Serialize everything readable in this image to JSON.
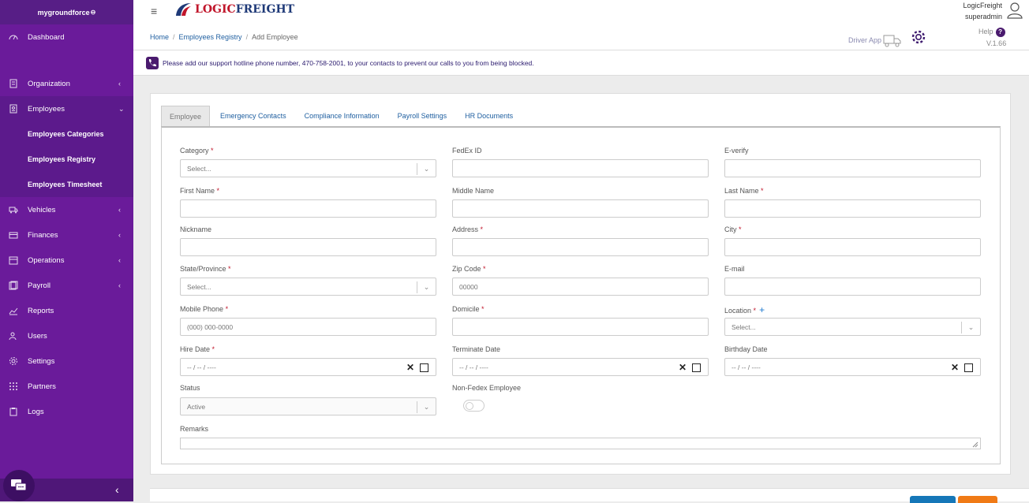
{
  "sidebar": {
    "brand": "mygroundforce",
    "items": [
      {
        "label": "Dashboard",
        "icon": "dashboard-icon"
      },
      {
        "label": "Organization",
        "icon": "building-icon"
      },
      {
        "label": "Employees",
        "icon": "id-badge-icon"
      },
      {
        "label": "Vehicles",
        "icon": "truck-icon"
      },
      {
        "label": "Finances",
        "icon": "wallet-icon"
      },
      {
        "label": "Operations",
        "icon": "calendar-icon"
      },
      {
        "label": "Payroll",
        "icon": "payroll-icon"
      },
      {
        "label": "Reports",
        "icon": "chart-icon"
      },
      {
        "label": "Users",
        "icon": "users-icon"
      },
      {
        "label": "Settings",
        "icon": "gear-icon"
      },
      {
        "label": "Partners",
        "icon": "grid-icon"
      },
      {
        "label": "Logs",
        "icon": "clipboard-icon"
      }
    ],
    "sub_items": [
      "Employees Categories",
      "Employees Registry",
      "Employees Timesheet"
    ]
  },
  "header": {
    "logo": {
      "part1": "LOGIC",
      "part2": "FREIGHT"
    },
    "user": {
      "name": "LogicFreight",
      "role": "superadmin"
    },
    "driver_app": "Driver App",
    "help": "Help",
    "help_icon": "?",
    "version": "V.1.66"
  },
  "breadcrumb": {
    "home": "Home",
    "registry": "Employees Registry",
    "current": "Add Employee"
  },
  "notice": "Please add our support hotline phone number, 470-758-2001, to your contacts to prevent our calls to you from being blocked.",
  "tabs": [
    "Employee",
    "Emergency Contacts",
    "Compliance Information",
    "Payroll Settings",
    "HR Documents"
  ],
  "form": {
    "category": {
      "label": "Category",
      "placeholder": "Select..."
    },
    "fedex_id": {
      "label": "FedEx ID"
    },
    "e_verify": {
      "label": "E-verify"
    },
    "first_name": {
      "label": "First Name"
    },
    "middle_name": {
      "label": "Middle Name"
    },
    "last_name": {
      "label": "Last Name"
    },
    "nickname": {
      "label": "Nickname"
    },
    "address": {
      "label": "Address"
    },
    "city": {
      "label": "City"
    },
    "state": {
      "label": "State/Province",
      "placeholder": "Select..."
    },
    "zip": {
      "label": "Zip Code",
      "placeholder": "00000"
    },
    "email": {
      "label": "E-mail"
    },
    "mobile": {
      "label": "Mobile Phone",
      "placeholder": "(000) 000-0000"
    },
    "domicile": {
      "label": "Domicile"
    },
    "location": {
      "label": "Location",
      "placeholder": "Select..."
    },
    "hire_date": {
      "label": "Hire Date",
      "placeholder": "-- / -- / ----"
    },
    "terminate_date": {
      "label": "Terminate Date",
      "placeholder": "-- / -- / ----"
    },
    "birthday": {
      "label": "Birthday Date",
      "placeholder": "-- / -- / ----"
    },
    "status": {
      "label": "Status",
      "value": "Active"
    },
    "non_fedex": {
      "label": "Non-Fedex Employee",
      "checked": false
    },
    "remarks": {
      "label": "Remarks"
    },
    "required_mark": "*"
  },
  "colors": {
    "sidebar": "#6a1b9a",
    "accent": "#1f5fa0",
    "required": "#c0162b",
    "save": "#1577b8",
    "cancel": "#f07a16"
  }
}
